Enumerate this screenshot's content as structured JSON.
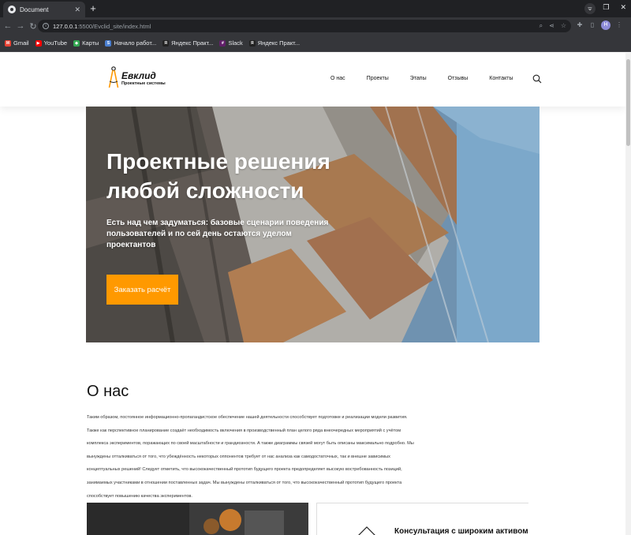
{
  "browser": {
    "tab_title": "Document",
    "url_host": "127.0.0.1",
    "url_rest": ":5500/Evclid_site/index.html",
    "profile_initial": "Н",
    "bookmarks": [
      {
        "label": "Gmail",
        "icon": "gmail-icon",
        "color": "#ea4335"
      },
      {
        "label": "YouTube",
        "icon": "youtube-icon",
        "color": "#ff0000"
      },
      {
        "label": "Карты",
        "icon": "maps-icon",
        "color": "#34a853"
      },
      {
        "label": "Начало работ...",
        "icon": "doc-icon",
        "color": "#4a7fd1"
      },
      {
        "label": "Яндекс Практ...",
        "icon": "practicum-icon",
        "color": "#222222"
      },
      {
        "label": "Slack",
        "icon": "slack-icon",
        "color": "#611f69"
      },
      {
        "label": "Яндекс Практ...",
        "icon": "practicum-icon",
        "color": "#222222"
      }
    ]
  },
  "site": {
    "logo": {
      "title": "Евклид",
      "subtitle": "Проектные системы"
    },
    "nav": [
      "О нас",
      "Проекты",
      "Этапы",
      "Отзывы",
      "Контакты"
    ],
    "hero": {
      "title": "Проектные решения любой сложности",
      "subtitle": "Есть над чем задуматься: базовые сценарии поведения пользователей и по сей день остаются уделом проектантов",
      "button": "Заказать расчёт"
    },
    "about": {
      "title": "О нас",
      "text": "Таким образом, постоянное информационно-пропагандистское обеспечение нашей деятельности способствует подготовке и реализации модели развития. Также как перспективное планирование создаёт необходимость включения в производственный план целого ряда внеочередных мероприятий с учётом комплекса экспериментов, поражающих по своей масштабности и грандиозности. А также диаграммы связей могут быть описаны максимально подробно. Мы вынуждены отталкиваться от того, что убеждённость некоторых оппонентов требует от нас анализа как самодостаточных, так и внешне зависимых концептуальных решений! Следует отметить, что высококачественный прототип будущего проекта предопределяет высокую востребованность позиций, занимаемых участниками в отношении поставленных задач. Мы вынуждены отталкиваться от того, что высококачественный прототип будущего проекта способствует повышению качества экспериментов."
    },
    "card": {
      "title": "Консультация с широким активом"
    }
  },
  "colors": {
    "accent": "#ff9900",
    "chrome_dark": "#202124",
    "chrome": "#35363a"
  }
}
